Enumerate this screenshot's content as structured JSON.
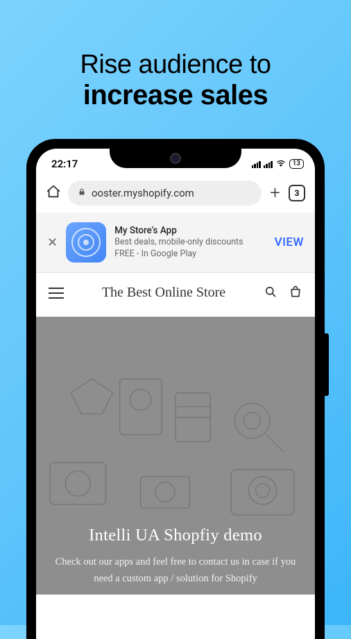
{
  "headline": {
    "line1": "Rise audience to",
    "line2": "increase sales"
  },
  "statusbar": {
    "time": "22:17",
    "battery": "13"
  },
  "browser": {
    "url": "ooster.myshopify.com",
    "tab_count": "3"
  },
  "appbanner": {
    "title": "My Store's App",
    "subtitle": "Best deals, mobile-only discounts",
    "footer": "FREE - In Google Play",
    "action": "VIEW"
  },
  "storehead": {
    "title": "The Best Online Store"
  },
  "hero": {
    "title": "Intelli UA Shopfiy demo",
    "subtitle": "Check out our apps and feel free to contact us in case if you need a custom app / solution for Shopify"
  }
}
